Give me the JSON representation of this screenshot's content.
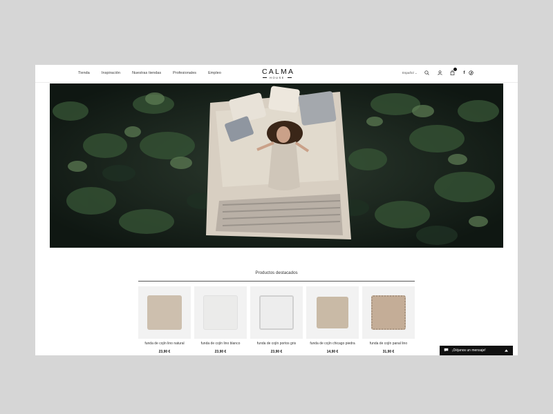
{
  "header": {
    "nav": [
      "Tienda",
      "Inspiración",
      "Nuestras tiendas",
      "Profesionales",
      "Empleo"
    ],
    "logo_top": "CALMA",
    "logo_bottom": "HOUSE",
    "language": "Español",
    "icons": [
      "search-icon",
      "user-icon",
      "bag-icon",
      "facebook-icon",
      "pinterest-icon"
    ],
    "facebook_glyph": "f"
  },
  "products": {
    "title": "Productos destacados",
    "items": [
      {
        "name": "funda de cojín lino natural",
        "price": "23,90 €",
        "color": "#cdbfae"
      },
      {
        "name": "funda de cojín lino blanco",
        "price": "23,90 €",
        "color": "#ebebea"
      },
      {
        "name": "funda de cojín portos gris",
        "price": "23,90 €",
        "color": "#ededed"
      },
      {
        "name": "funda de cojín chicago piedra",
        "price": "14,90 €",
        "color": "#c9baa6"
      },
      {
        "name": "funda de cojín panal lino",
        "price": "31,90 €",
        "color": "#c4ad97"
      }
    ]
  },
  "chat": {
    "label": "¡Déjanos un mensaje!"
  }
}
